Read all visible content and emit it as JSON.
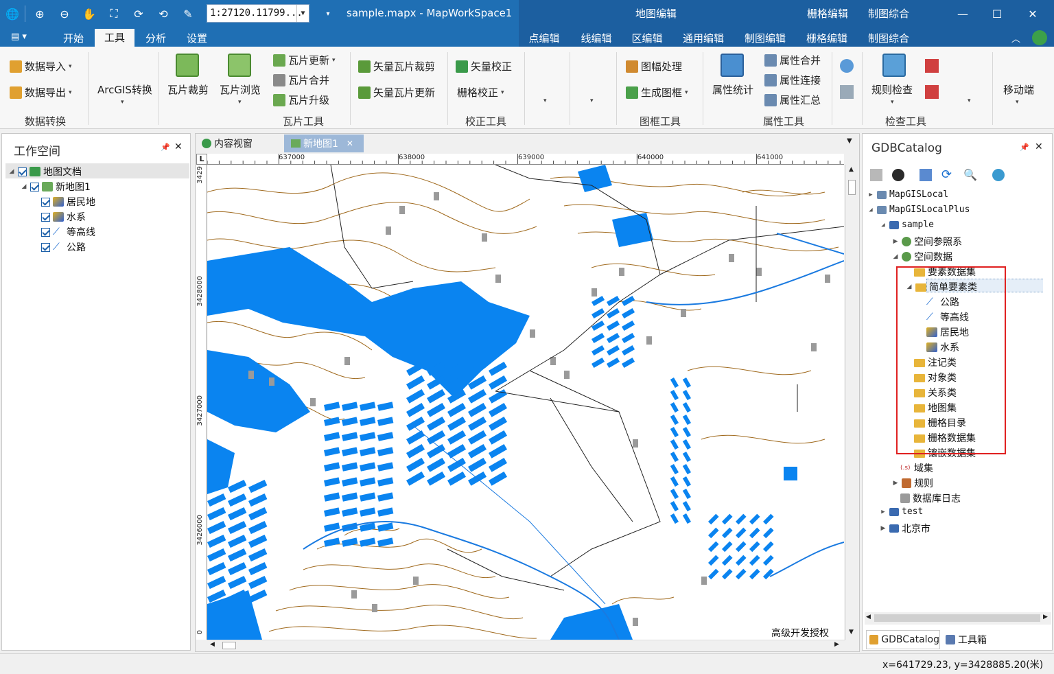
{
  "title": {
    "scale": "1:27120.11799...",
    "document": "sample.mapx - MapWorkSpace1"
  },
  "context_tabs": {
    "map_edit": "地图编辑",
    "raster_edit": "栅格编辑",
    "cartography": "制图综合",
    "sub": [
      "点编辑",
      "线编辑",
      "区编辑",
      "通用编辑",
      "制图编辑",
      "栅格编辑",
      "制图综合"
    ]
  },
  "tabs": [
    "开始",
    "工具",
    "分析",
    "设置"
  ],
  "ribbon": {
    "data_import": "数据导入",
    "data_export": "数据导出",
    "arcgis": "ArcGIS转换",
    "tile_clip": "瓦片裁剪",
    "tile_browse": "瓦片浏览",
    "tile_update": "瓦片更新",
    "tile_merge": "瓦片合并",
    "tile_upgrade": "瓦片升级",
    "vec_tile_clip": "矢量瓦片裁剪",
    "vec_tile_update": "矢量瓦片更新",
    "vec_correct": "矢量校正",
    "raster_correct": "栅格校正",
    "sheet_process": "图幅处理",
    "gen_frame": "生成图框",
    "attr_stats": "属性统计",
    "attr_merge": "属性合并",
    "attr_join": "属性连接",
    "attr_summary": "属性汇总",
    "rule_check": "规则检查",
    "mobile": "移动端",
    "groups": [
      "数据转换",
      "瓦片工具",
      "校正工具",
      "图框工具",
      "属性工具",
      "检查工具"
    ]
  },
  "workspace": {
    "title": "工作空间",
    "items": [
      {
        "label": "地图文档"
      },
      {
        "label": "新地图1"
      },
      {
        "label": "居民地"
      },
      {
        "label": "水系"
      },
      {
        "label": "等高线"
      },
      {
        "label": "公路"
      }
    ]
  },
  "map_tabs": [
    "内容视窗",
    "新地图1"
  ],
  "ruler": {
    "corner": "L",
    "x_ticks": [
      "637000",
      "638000",
      "639000",
      "640000",
      "641000"
    ],
    "y_ticks": [
      "3429",
      "3428000",
      "3427000",
      "3426000",
      "0"
    ]
  },
  "map_watermark": "高级开发授权",
  "catalog": {
    "title": "GDBCatalog",
    "items": [
      "MapGISLocal",
      "MapGISLocalPlus",
      "sample",
      "空间参照系",
      "空间数据",
      "要素数据集",
      "简单要素类",
      "公路",
      "等高线",
      "居民地",
      "水系",
      "注记类",
      "对象类",
      "关系类",
      "地图集",
      "栅格目录",
      "栅格数据集",
      "镶嵌数据集",
      "域集",
      "规则",
      "数据库日志",
      "test",
      "北京市"
    ],
    "bottom_tabs": [
      "GDBCatalog",
      "工具箱"
    ],
    "highlight_color": "#e02020"
  },
  "status": {
    "coords": "x=641729.23, y=3428885.20(米)"
  },
  "colors": {
    "title_bg": "#1f6fb4",
    "water": "#0a84f0",
    "contour": "#a06a1e",
    "roads": "#222222",
    "settlement": "#9a9a9a"
  }
}
